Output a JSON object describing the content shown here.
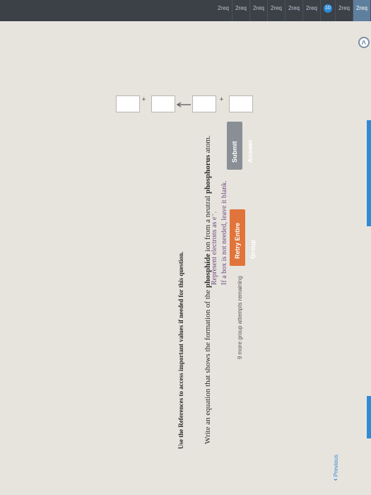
{
  "sidebar": {
    "items": [
      {
        "label": "2req",
        "state": "active"
      },
      {
        "label": "2req",
        "state": ""
      },
      {
        "label": "2req",
        "state": "marker",
        "badge": "10"
      },
      {
        "label": "2req",
        "state": ""
      },
      {
        "label": "2req",
        "state": ""
      },
      {
        "label": "2req",
        "state": ""
      },
      {
        "label": "2req",
        "state": ""
      },
      {
        "label": "2req",
        "state": ""
      },
      {
        "label": "2req",
        "state": ""
      }
    ]
  },
  "collapse_button": {
    "glyph": "<"
  },
  "references_note": "Use the References to access important values if needed for this question.",
  "question": {
    "prefix": "Write an equation that shows the formation of the ",
    "species": "phosphide",
    "middle": " ion from a neutral ",
    "element": "phosphorus",
    "suffix": " atom."
  },
  "instructions": {
    "line1": "Represent electrons as e⁻.",
    "line2": "If a box is not needed, leave it blank."
  },
  "equation": {
    "plus": "+",
    "arrow": "→"
  },
  "buttons": {
    "submit": "Submit Answer",
    "retry": "Retry Entire Group"
  },
  "attempts_text": "9 more group attempts remaining",
  "previous_label": "Previous",
  "colors": {
    "accent": "#2d8bd6",
    "retry": "#e0743a",
    "submit": "#8a8f96",
    "sidebar": "#3c4148"
  }
}
